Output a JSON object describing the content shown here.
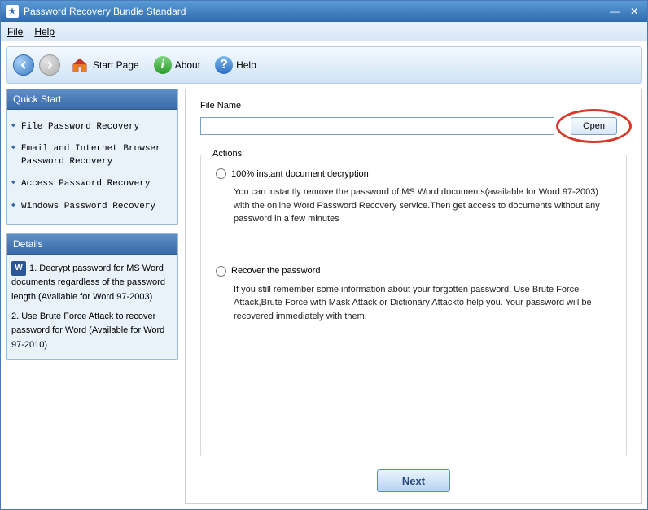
{
  "window": {
    "title": "Password Recovery Bundle Standard"
  },
  "menu": {
    "file": "File",
    "help": "Help"
  },
  "toolbar": {
    "start_page": "Start Page",
    "about": "About",
    "help": "Help"
  },
  "sidebar": {
    "quick_start": {
      "title": "Quick Start",
      "items": [
        "File Password Recovery",
        "Email and Internet Browser Password Recovery",
        "Access Password Recovery",
        "Windows Password Recovery"
      ]
    },
    "details": {
      "title": "Details",
      "item1": "1. Decrypt password for MS Word documents regardless of the password length.(Available for Word 97-2003)",
      "item2": "2. Use Brute Force Attack to recover password for Word (Available for Word 97-2010)"
    }
  },
  "main": {
    "file_name_label": "File Name",
    "file_name_value": "",
    "open_label": "Open",
    "actions_label": "Actions:",
    "option1": {
      "label": "100% instant document decryption",
      "desc": "You can instantly remove the password of MS Word documents(available for Word 97-2003) with the online Word Password Recovery service.Then get access to documents without any password in a few minutes"
    },
    "option2": {
      "label": "Recover the password",
      "desc": "If you still remember some information about your forgotten password, Use Brute Force Attack,Brute Force with Mask Attack or Dictionary Attackto help you. Your password will be recovered immediately with them."
    },
    "next_label": "Next"
  }
}
